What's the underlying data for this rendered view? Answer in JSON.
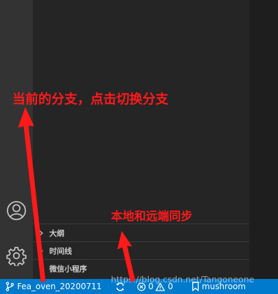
{
  "annotations": {
    "branch_note": "当前的分支，点击切换分支",
    "sync_note": "本地和远端同步"
  },
  "sidebar": {
    "sections": [
      {
        "label": "大纲"
      },
      {
        "label": "时间线"
      },
      {
        "label": "微信小程序"
      }
    ]
  },
  "statusbar": {
    "branch": "Fea_oven_20200711",
    "errors": "0",
    "warnings": "0",
    "account": "mushroom"
  },
  "watermark": "https://blog.csdn.net/Tangoneone",
  "colors": {
    "statusbar_bg": "#007acc",
    "activity_bar_bg": "#333333",
    "side_panel_bg": "#252526",
    "annotation": "#ff1a1a"
  },
  "icons": [
    "account-icon",
    "gear-icon",
    "chevron-right-icon",
    "git-branch-icon",
    "sync-icon",
    "error-icon",
    "warning-icon",
    "bookmark-icon",
    "arrow-annotation"
  ]
}
